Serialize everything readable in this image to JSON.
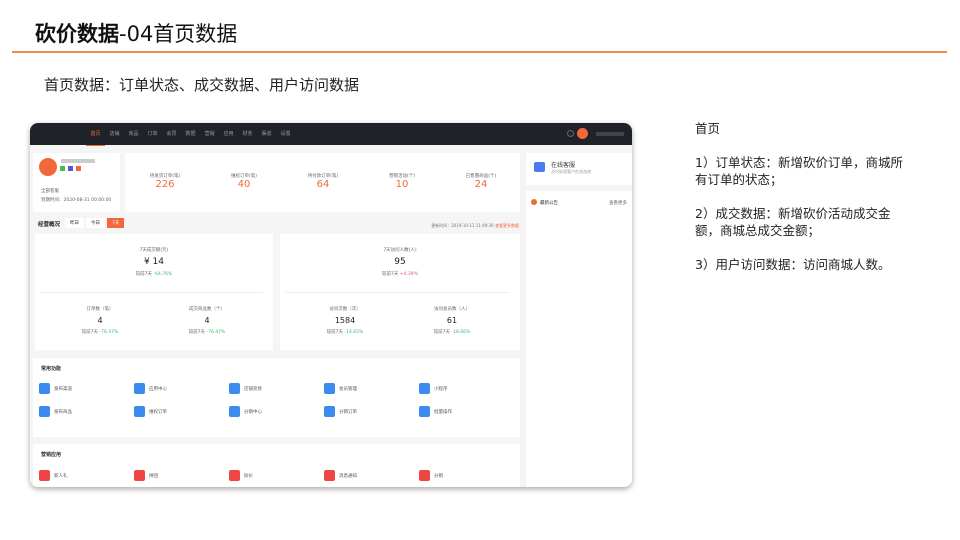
{
  "slide": {
    "title_bold": "砍价数据",
    "title_rest": "-04首页数据",
    "subtitle": "首页数据：订单状态、成交数据、用户访问数据",
    "notes": [
      "首页",
      "1）订单状态：新增砍价订单，商城所有订单的状态；",
      "2）成交数据：新增砍价活动成交金额，商城总成交金额；",
      "3）用户访问数据：访问商城人数。"
    ]
  },
  "app": {
    "nav": [
      "首页",
      "店铺",
      "商品",
      "订单",
      "会员",
      "数据",
      "营销",
      "应用",
      "财务",
      "渠道",
      "设置"
    ],
    "shop": {
      "service": "全部客服",
      "expiry": "到期时间：2020-08-31 00:00:00"
    },
    "stats": [
      {
        "label": "待发货订单(笔)",
        "value": "226"
      },
      {
        "label": "维权订单(笔)",
        "value": "40"
      },
      {
        "label": "待付款订单(笔)",
        "value": "64"
      },
      {
        "label": "营销活动(个)",
        "value": "10"
      },
      {
        "label": "已售罄商品(个)",
        "value": "24"
      }
    ],
    "overview": {
      "title": "经营概况",
      "tabs": [
        "昨日",
        "今日",
        "7天"
      ],
      "updated": "更新时间：2019-10-11 11:49:36",
      "more": "查看更多数据"
    },
    "sales": {
      "label": "7天成交额(元)",
      "value": "¥ 14",
      "cmp": "较前7天",
      "change": "-64.76%",
      "sub": [
        {
          "label": "订单数（笔）",
          "value": "4",
          "cmp": "较前7天",
          "change": "-76.47%"
        },
        {
          "label": "成交商品数（个）",
          "value": "4",
          "cmp": "较前7天",
          "change": "-76.47%"
        }
      ]
    },
    "visits": {
      "label": "7天访问人数(人)",
      "value": "95",
      "cmp": "较前7天",
      "change": "+4.39%",
      "sub": [
        {
          "label": "访问次数（次）",
          "value": "1584",
          "cmp": "较前7天",
          "change": "-14.65%"
        },
        {
          "label": "访问会员数（人）",
          "value": "61",
          "cmp": "较前7天",
          "change": "-18.66%"
        }
      ]
    },
    "common": {
      "title": "常用功能",
      "items": [
        "发布渠道",
        "应用中心",
        "店铺装修",
        "会员管理",
        "小程序",
        "发布商品",
        "维权订单",
        "分销中心",
        "分销订单",
        "批量操作"
      ]
    },
    "marketing": {
      "title": "营销应用",
      "items": [
        "新人礼",
        "拼团",
        "砍价",
        "消息通知",
        "分销"
      ]
    },
    "service": {
      "title": "在线客服",
      "desc": "及时处理客户在线咨询"
    },
    "notice": {
      "title": "最新公告",
      "more": "查看更多"
    },
    "colors": {
      "accent": "#f2683a",
      "nav_bg": "#1f2229",
      "icon_blue": "#3d8bf0",
      "icon_red": "#f04545"
    }
  }
}
